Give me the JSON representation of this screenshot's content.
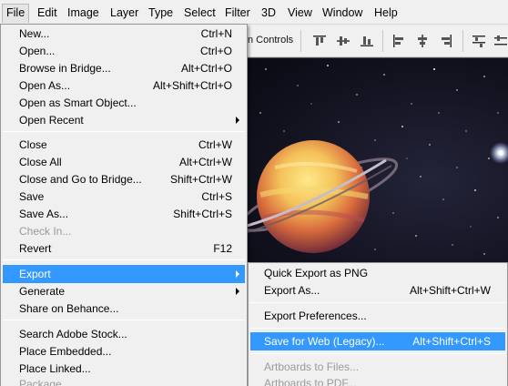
{
  "menubar": [
    "File",
    "Edit",
    "Image",
    "Layer",
    "Type",
    "Select",
    "Filter",
    "3D",
    "View",
    "Window",
    "Help"
  ],
  "options_bar": {
    "partial_label": "n Controls"
  },
  "file_menu": [
    {
      "label": "New...",
      "shortcut": "Ctrl+N"
    },
    {
      "label": "Open...",
      "shortcut": "Ctrl+O"
    },
    {
      "label": "Browse in Bridge...",
      "shortcut": "Alt+Ctrl+O"
    },
    {
      "label": "Open As...",
      "shortcut": "Alt+Shift+Ctrl+O"
    },
    {
      "label": "Open as Smart Object...",
      "shortcut": ""
    },
    {
      "label": "Open Recent",
      "shortcut": "",
      "submenu": true
    },
    {
      "label": "Close",
      "shortcut": "Ctrl+W"
    },
    {
      "label": "Close All",
      "shortcut": "Alt+Ctrl+W"
    },
    {
      "label": "Close and Go to Bridge...",
      "shortcut": "Shift+Ctrl+W"
    },
    {
      "label": "Save",
      "shortcut": "Ctrl+S"
    },
    {
      "label": "Save As...",
      "shortcut": "Shift+Ctrl+S"
    },
    {
      "label": "Check In...",
      "shortcut": "",
      "disabled": true
    },
    {
      "label": "Revert",
      "shortcut": "F12"
    },
    {
      "label": "Export",
      "shortcut": "",
      "submenu": true,
      "highlighted": true
    },
    {
      "label": "Generate",
      "shortcut": "",
      "submenu": true
    },
    {
      "label": "Share on Behance...",
      "shortcut": ""
    },
    {
      "label": "Search Adobe Stock...",
      "shortcut": ""
    },
    {
      "label": "Place Embedded...",
      "shortcut": ""
    },
    {
      "label": "Place Linked...",
      "shortcut": ""
    },
    {
      "label": "Package...",
      "shortcut": "",
      "disabled": true
    }
  ],
  "export_submenu": [
    {
      "label": "Quick Export as PNG",
      "shortcut": ""
    },
    {
      "label": "Export As...",
      "shortcut": "Alt+Shift+Ctrl+W"
    },
    {
      "label": "Export Preferences...",
      "shortcut": ""
    },
    {
      "label": "Save for Web (Legacy)...",
      "shortcut": "Alt+Shift+Ctrl+S",
      "highlighted": true
    },
    {
      "label": "Artboards to Files...",
      "shortcut": "",
      "disabled": true
    },
    {
      "label": "Artboards to PDF...",
      "shortcut": "",
      "disabled": true
    }
  ]
}
